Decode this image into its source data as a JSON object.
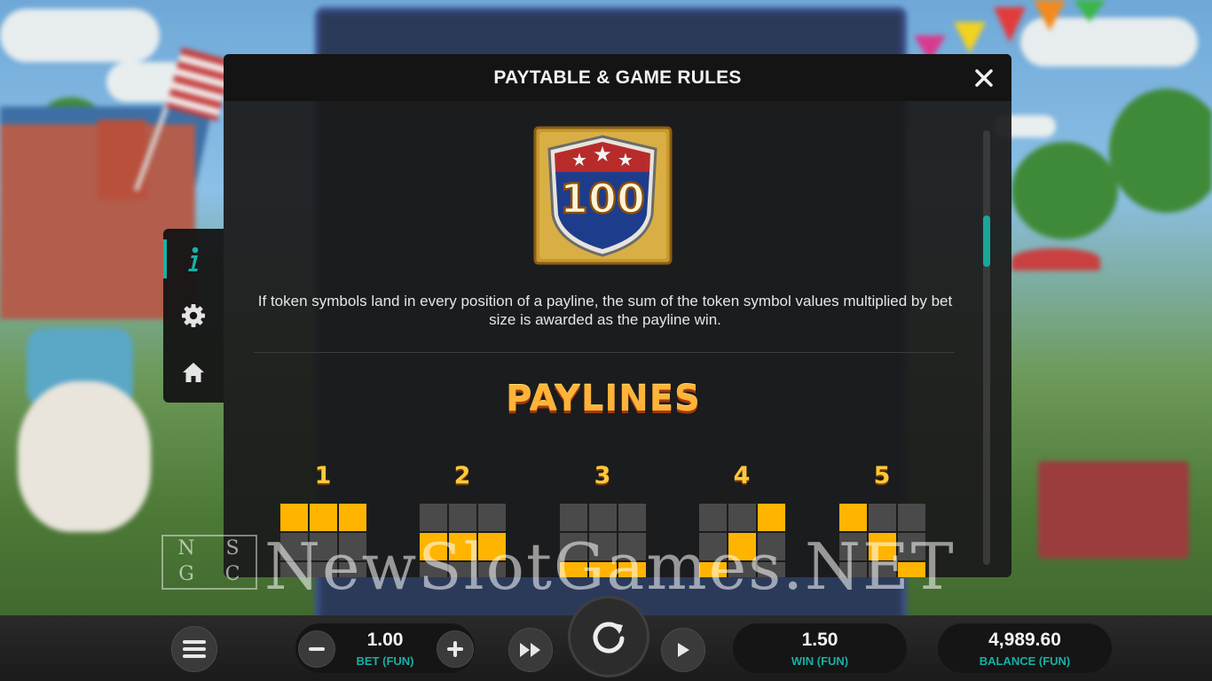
{
  "dialog": {
    "title": "PAYTABLE & GAME RULES",
    "token_value": "100",
    "token_description": "If token symbols land in every position of a payline, the sum of the token symbol values multiplied by bet size is awarded as the payline win.",
    "paylines_heading": "PAYLINES",
    "paylines": [
      {
        "number": "1",
        "pattern": [
          1,
          1,
          1,
          0,
          0,
          0,
          0,
          0,
          0
        ]
      },
      {
        "number": "2",
        "pattern": [
          0,
          0,
          0,
          1,
          1,
          1,
          0,
          0,
          0
        ]
      },
      {
        "number": "3",
        "pattern": [
          0,
          0,
          0,
          0,
          0,
          0,
          1,
          1,
          1
        ]
      },
      {
        "number": "4",
        "pattern": [
          0,
          0,
          1,
          0,
          1,
          0,
          1,
          0,
          0
        ]
      },
      {
        "number": "5",
        "pattern": [
          1,
          0,
          0,
          0,
          1,
          0,
          0,
          0,
          1
        ]
      }
    ]
  },
  "side_menu": {
    "items": [
      {
        "name": "info",
        "icon": "info-icon",
        "active": true
      },
      {
        "name": "settings",
        "icon": "gear-icon",
        "active": false
      },
      {
        "name": "home",
        "icon": "home-icon",
        "active": false
      }
    ]
  },
  "bottom_bar": {
    "bet_value": "1.00",
    "bet_label": "BET (FUN)",
    "win_value": "1.50",
    "win_label": "WIN (FUN)",
    "balance_value": "4,989.60",
    "balance_label": "BALANCE (FUN)"
  },
  "watermark": {
    "text": "NewSlotGames.NET",
    "logo_letters": [
      "N",
      "S",
      "G",
      "C"
    ]
  },
  "colors": {
    "accent_teal": "#17b3a6",
    "payline_on": "#ffb400",
    "payline_off": "#4a4a4a",
    "heading_orange": "#ffb338"
  }
}
